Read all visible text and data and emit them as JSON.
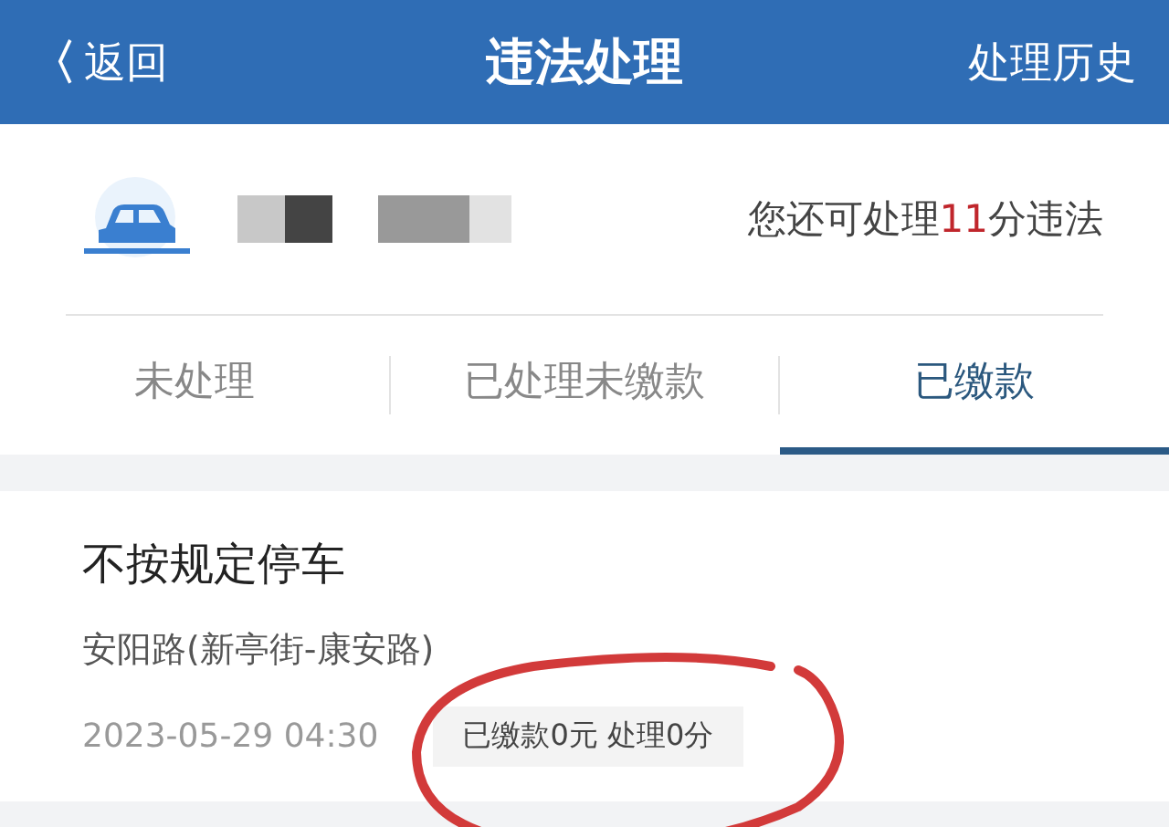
{
  "header": {
    "back_icon": "〈",
    "back_label": "返回",
    "title": "违法处理",
    "history_link": "处理历史"
  },
  "vehicle": {
    "remaining_prefix": "您还可处理",
    "remaining_points": "11",
    "remaining_suffix": "分违法"
  },
  "tabs": [
    {
      "label": "未处理",
      "selected": false
    },
    {
      "label": "已处理未缴款",
      "selected": false
    },
    {
      "label": "已缴款",
      "selected": true
    }
  ],
  "records": [
    {
      "violation": "不按规定停车",
      "location": "安阳路(新亭街-康安路)",
      "time": "2023-05-29 04:30",
      "status": "已缴款0元 处理0分",
      "circled": true
    }
  ]
}
